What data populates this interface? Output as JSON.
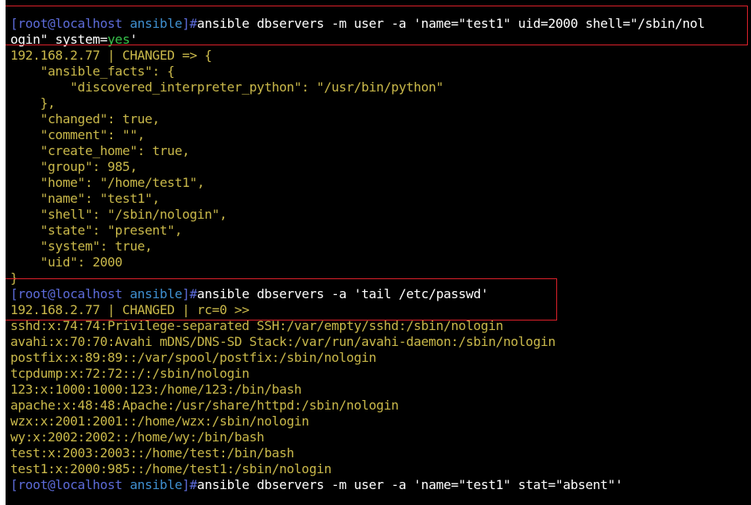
{
  "prompt": {
    "user_host": "[root@localhost",
    "dir": "ansible",
    "close": "]#"
  },
  "lines": [
    {
      "kind": "faded",
      "text": "                            "
    },
    {
      "kind": "cmd",
      "cmd": "ansible dbservers -m user -a 'name=\"test1\" uid=2000 shell=\"/sbin/nol"
    },
    {
      "kind": "wrap",
      "a": "ogin\" system=",
      "b": "yes",
      "c": "'"
    },
    {
      "kind": "out",
      "text": "192.168.2.77 | CHANGED => {"
    },
    {
      "kind": "out",
      "text": "    \"ansible_facts\": {"
    },
    {
      "kind": "out",
      "text": "        \"discovered_interpreter_python\": \"/usr/bin/python\""
    },
    {
      "kind": "out",
      "text": "    },"
    },
    {
      "kind": "out",
      "text": "    \"changed\": true,"
    },
    {
      "kind": "out",
      "text": "    \"comment\": \"\","
    },
    {
      "kind": "out",
      "text": "    \"create_home\": true,"
    },
    {
      "kind": "out",
      "text": "    \"group\": 985,"
    },
    {
      "kind": "out",
      "text": "    \"home\": \"/home/test1\","
    },
    {
      "kind": "out",
      "text": "    \"name\": \"test1\","
    },
    {
      "kind": "out",
      "text": "    \"shell\": \"/sbin/nologin\","
    },
    {
      "kind": "out",
      "text": "    \"state\": \"present\","
    },
    {
      "kind": "out",
      "text": "    \"system\": true,"
    },
    {
      "kind": "out",
      "text": "    \"uid\": 2000"
    },
    {
      "kind": "out",
      "text": "}"
    },
    {
      "kind": "cmd",
      "cmd": "ansible dbservers -a 'tail /etc/passwd'"
    },
    {
      "kind": "out",
      "text": "192.168.2.77 | CHANGED | rc=0 >>"
    },
    {
      "kind": "out",
      "text": "sshd:x:74:74:Privilege-separated SSH:/var/empty/sshd:/sbin/nologin"
    },
    {
      "kind": "out",
      "text": "avahi:x:70:70:Avahi mDNS/DNS-SD Stack:/var/run/avahi-daemon:/sbin/nologin"
    },
    {
      "kind": "out",
      "text": "postfix:x:89:89::/var/spool/postfix:/sbin/nologin"
    },
    {
      "kind": "out",
      "text": "tcpdump:x:72:72::/:/sbin/nologin"
    },
    {
      "kind": "out",
      "text": "123:x:1000:1000:123:/home/123:/bin/bash"
    },
    {
      "kind": "out",
      "text": "apache:x:48:48:Apache:/usr/share/httpd:/sbin/nologin"
    },
    {
      "kind": "out",
      "text": "wzx:x:2001:2001::/home/wzx:/sbin/nologin"
    },
    {
      "kind": "out",
      "text": "wy:x:2002:2002::/home/wy:/bin/bash"
    },
    {
      "kind": "out",
      "text": "test:x:2003:2003::/home/test:/bin/bash"
    },
    {
      "kind": "out",
      "text": "test1:x:2000:985::/home/test1:/sbin/nologin"
    },
    {
      "kind": "cmd",
      "cmd": "ansible dbservers -m user -a 'name=\"test1\" stat=\"absent\"'"
    }
  ]
}
